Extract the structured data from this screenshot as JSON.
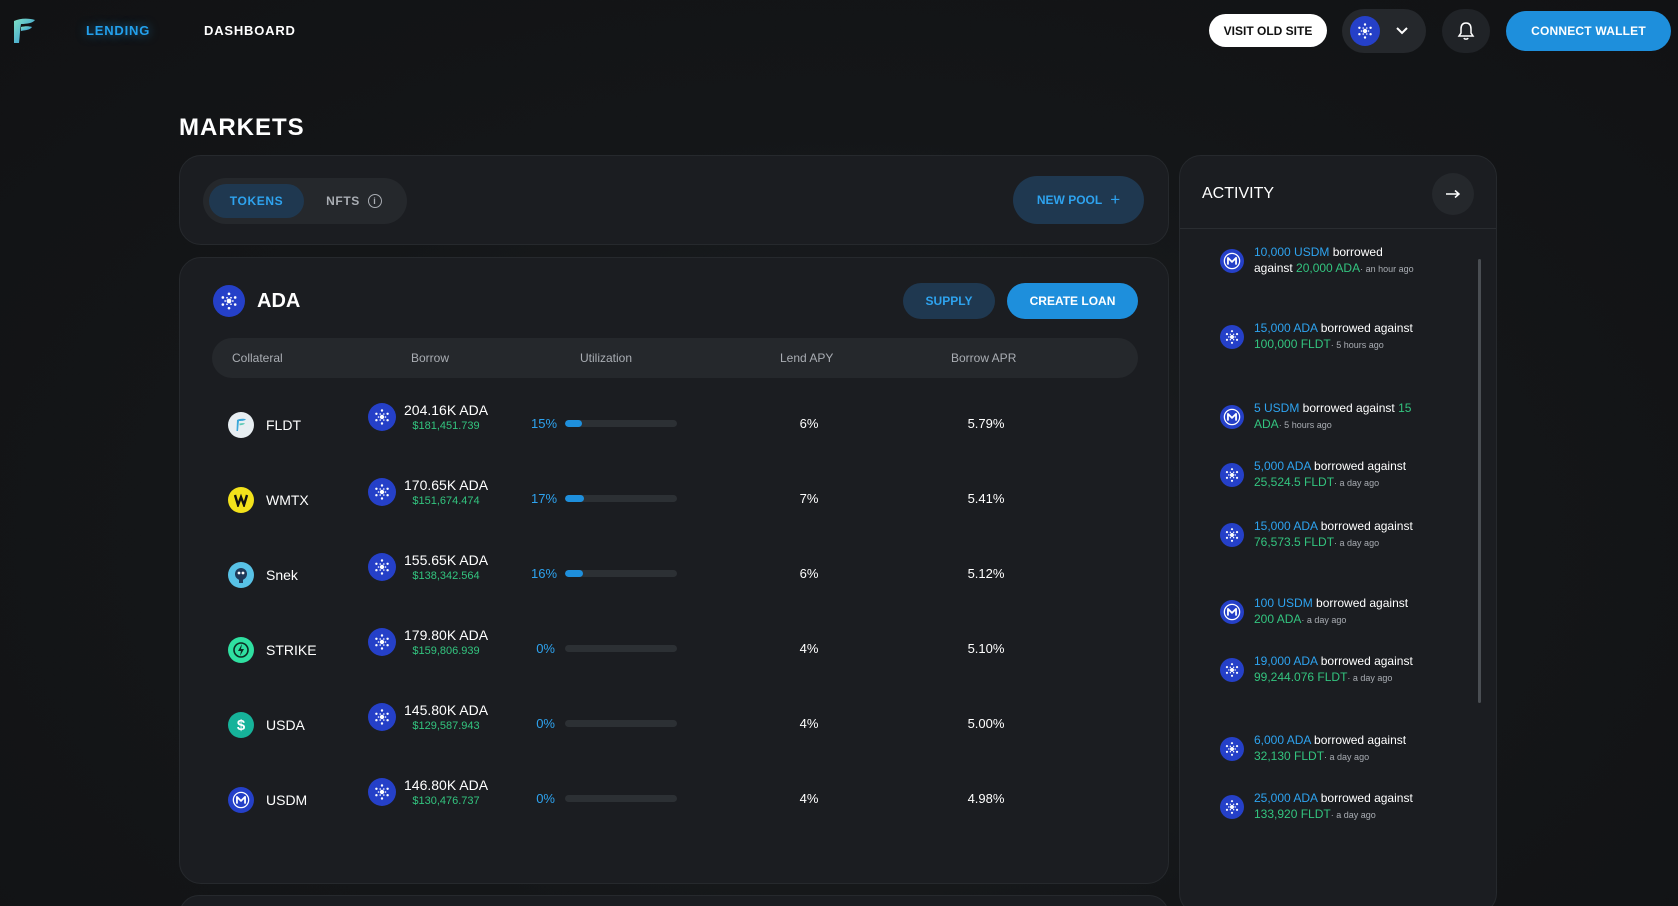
{
  "nav": {
    "lending": "LENDING",
    "dashboard": "DASHBOARD",
    "visit_old_site": "VISIT OLD SITE",
    "connect_wallet": "CONNECT WALLET"
  },
  "page_title": "MARKETS",
  "tabs": {
    "tokens": "TOKENS",
    "nfts": "NFTS",
    "new_pool": "NEW POOL"
  },
  "pool": {
    "name": "ADA",
    "supply": "SUPPLY",
    "create_loan": "CREATE LOAN",
    "headers": {
      "collateral": "Collateral",
      "borrow": "Borrow",
      "utilization": "Utilization",
      "lend_apy": "Lend APY",
      "borrow_apr": "Borrow APR"
    },
    "rows": [
      {
        "token": "FLDT",
        "icon": "fldt-icon",
        "borrow": "204.16K ADA",
        "usd": "$181,451.739",
        "util": "15%",
        "util_fill": 0.15,
        "lend_apy": "6%",
        "borrow_apr": "5.79%"
      },
      {
        "token": "WMTX",
        "icon": "wmtx-icon",
        "borrow": "170.65K ADA",
        "usd": "$151,674.474",
        "util": "17%",
        "util_fill": 0.17,
        "lend_apy": "7%",
        "borrow_apr": "5.41%"
      },
      {
        "token": "Snek",
        "icon": "snek-icon",
        "borrow": "155.65K ADA",
        "usd": "$138,342.564",
        "util": "16%",
        "util_fill": 0.16,
        "lend_apy": "6%",
        "borrow_apr": "5.12%"
      },
      {
        "token": "STRIKE",
        "icon": "strike-icon",
        "borrow": "179.80K ADA",
        "usd": "$159,806.939",
        "util": "0%",
        "util_fill": 0,
        "lend_apy": "4%",
        "borrow_apr": "5.10%"
      },
      {
        "token": "USDA",
        "icon": "usda-icon",
        "borrow": "145.80K ADA",
        "usd": "$129,587.943",
        "util": "0%",
        "util_fill": 0,
        "lend_apy": "4%",
        "borrow_apr": "5.00%"
      },
      {
        "token": "USDM",
        "icon": "usdm-icon",
        "borrow": "146.80K ADA",
        "usd": "$130,476.737",
        "util": "0%",
        "util_fill": 0,
        "lend_apy": "4%",
        "borrow_apr": "4.98%"
      }
    ]
  },
  "activity": {
    "title": "ACTIVITY",
    "items": [
      {
        "coin": "usdm",
        "amount": "10,000 USDM",
        "mid": " borrowed against ",
        "collateral": "20,000 ADA",
        "ago": "· an hour ago"
      },
      {
        "coin": "ada",
        "amount": "15,000 ADA",
        "mid": " borrowed against ",
        "collateral": "100,000 FLDT",
        "ago": "· 5 hours ago"
      },
      {
        "coin": "usdm",
        "amount": "5 USDM",
        "mid": " borrowed against ",
        "collateral": "15 ADA",
        "ago": "· 5 hours ago"
      },
      {
        "coin": "ada",
        "amount": "5,000 ADA",
        "mid": " borrowed against ",
        "collateral": "25,524.5 FLDT",
        "ago": "· a day ago"
      },
      {
        "coin": "ada",
        "amount": "15,000 ADA",
        "mid": " borrowed against ",
        "collateral": "76,573.5 FLDT",
        "ago": "· a day ago"
      },
      {
        "coin": "usdm",
        "amount": "100 USDM",
        "mid": " borrowed against ",
        "collateral": "200 ADA",
        "ago": "· a day ago"
      },
      {
        "coin": "ada",
        "amount": "19,000 ADA",
        "mid": " borrowed against ",
        "collateral": "99,244.076 FLDT",
        "ago": "· a day ago"
      },
      {
        "coin": "ada",
        "amount": "6,000 ADA",
        "mid": " borrowed against ",
        "collateral": "32,130 FLDT",
        "ago": "· a day ago"
      },
      {
        "coin": "ada",
        "amount": "25,000 ADA",
        "mid": " borrowed against ",
        "collateral": "133,920 FLDT",
        "ago": "· a day ago"
      }
    ]
  },
  "colors": {
    "accent": "#1e8fdc",
    "accent_text": "#2ea3ef",
    "positive": "#33c47f",
    "ada_coin": "#2540c8"
  }
}
